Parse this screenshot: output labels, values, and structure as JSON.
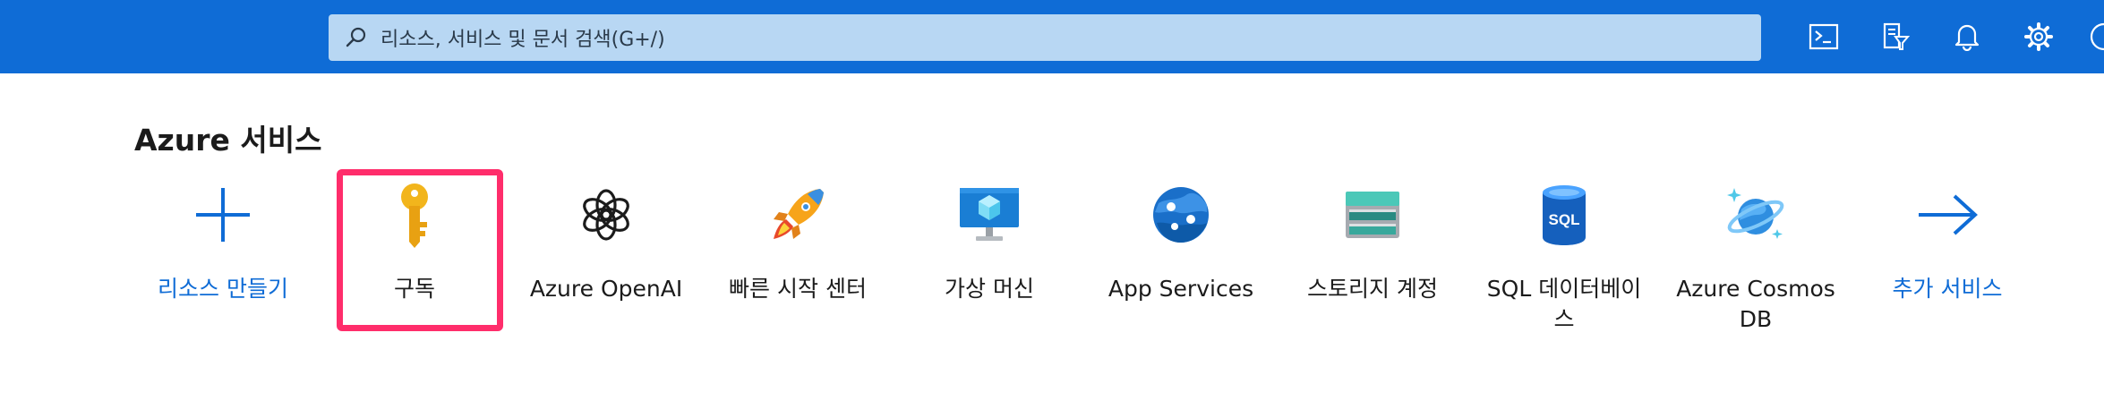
{
  "search": {
    "placeholder": "리소스, 서비스 및 문서 검색(G+/)"
  },
  "top_icons": [
    "cloud-shell-icon",
    "directory-filter-icon",
    "notifications-bell-icon",
    "settings-gear-icon"
  ],
  "section": {
    "title": "Azure 서비스"
  },
  "services": [
    {
      "label": "리소스 만들기",
      "icon": "plus-icon",
      "link": true
    },
    {
      "label": "구독",
      "icon": "key-icon",
      "link": false,
      "highlighted": true
    },
    {
      "label": "Azure OpenAI",
      "icon": "openai-icon",
      "link": false
    },
    {
      "label": "빠른 시작 센터",
      "icon": "rocket-icon",
      "link": false
    },
    {
      "label": "가상 머신",
      "icon": "virtual-machine-icon",
      "link": false
    },
    {
      "label": "App Services",
      "icon": "app-services-globe-icon",
      "link": false
    },
    {
      "label": "스토리지 계정",
      "icon": "storage-account-icon",
      "link": false
    },
    {
      "label": "SQL 데이터베이스",
      "icon": "sql-database-icon",
      "link": false
    },
    {
      "label": "Azure Cosmos DB",
      "icon": "cosmos-db-icon",
      "link": false
    },
    {
      "label": "추가 서비스",
      "icon": "arrow-right-icon",
      "link": true
    }
  ],
  "colors": {
    "topbar": "#0f6cd6",
    "search_bg": "#b8d7f3",
    "link": "#0f6cd6",
    "highlight": "#ff2d6b"
  }
}
